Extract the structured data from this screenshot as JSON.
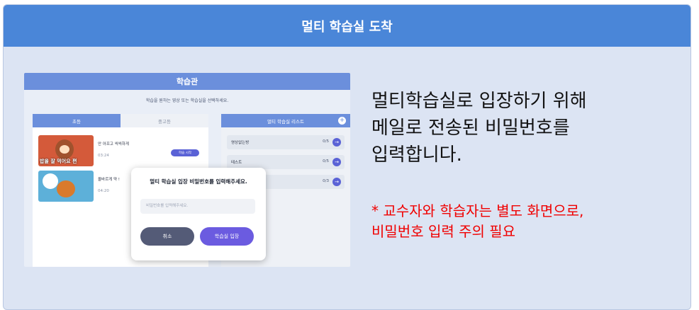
{
  "header": {
    "title": "멀티 학습실 도착"
  },
  "screenshot": {
    "top_title": "학습관",
    "subtitle": "학습을 원하는 영상 또는 학습실을 선택하세요.",
    "tabs": [
      "초등",
      "중고등"
    ],
    "videos": [
      {
        "title": "안 아프고 씩씩하게",
        "time": "03:24",
        "thumb_caption": "밥을 잘 먹어요 편"
      },
      {
        "title": "올바르게 약 !",
        "time": "04:20",
        "thumb_caption": ""
      }
    ],
    "start_button": "학습 시작",
    "room_list": {
      "title": "멀티 학습실 리스트",
      "add_icon": "plus-icon",
      "rooms": [
        {
          "name": "영상없는방",
          "count": "0/5"
        },
        {
          "name": "테스트",
          "count": "0/5"
        },
        {
          "name": "",
          "count": "0/3"
        }
      ]
    },
    "modal": {
      "title": "멀티 학습실 입장 비밀번호를 입력해주세요.",
      "input_placeholder": "비밀번호를 입력해주세요.",
      "cancel": "취소",
      "enter": "학습실 입장"
    }
  },
  "description": {
    "lines": [
      "멀티학습실로 입장하기 위해",
      "메일로 전송된 비밀번호를",
      "입력합니다."
    ]
  },
  "note": {
    "lines": [
      "* 교수자와 학습자는 별도 화면으로,",
      "비밀번호 입력 주의 필요"
    ],
    "color": "#f00000"
  },
  "colors": {
    "header_bg": "#4a86d8",
    "card_bg": "#dce4f3",
    "accent": "#6b8fdc"
  }
}
